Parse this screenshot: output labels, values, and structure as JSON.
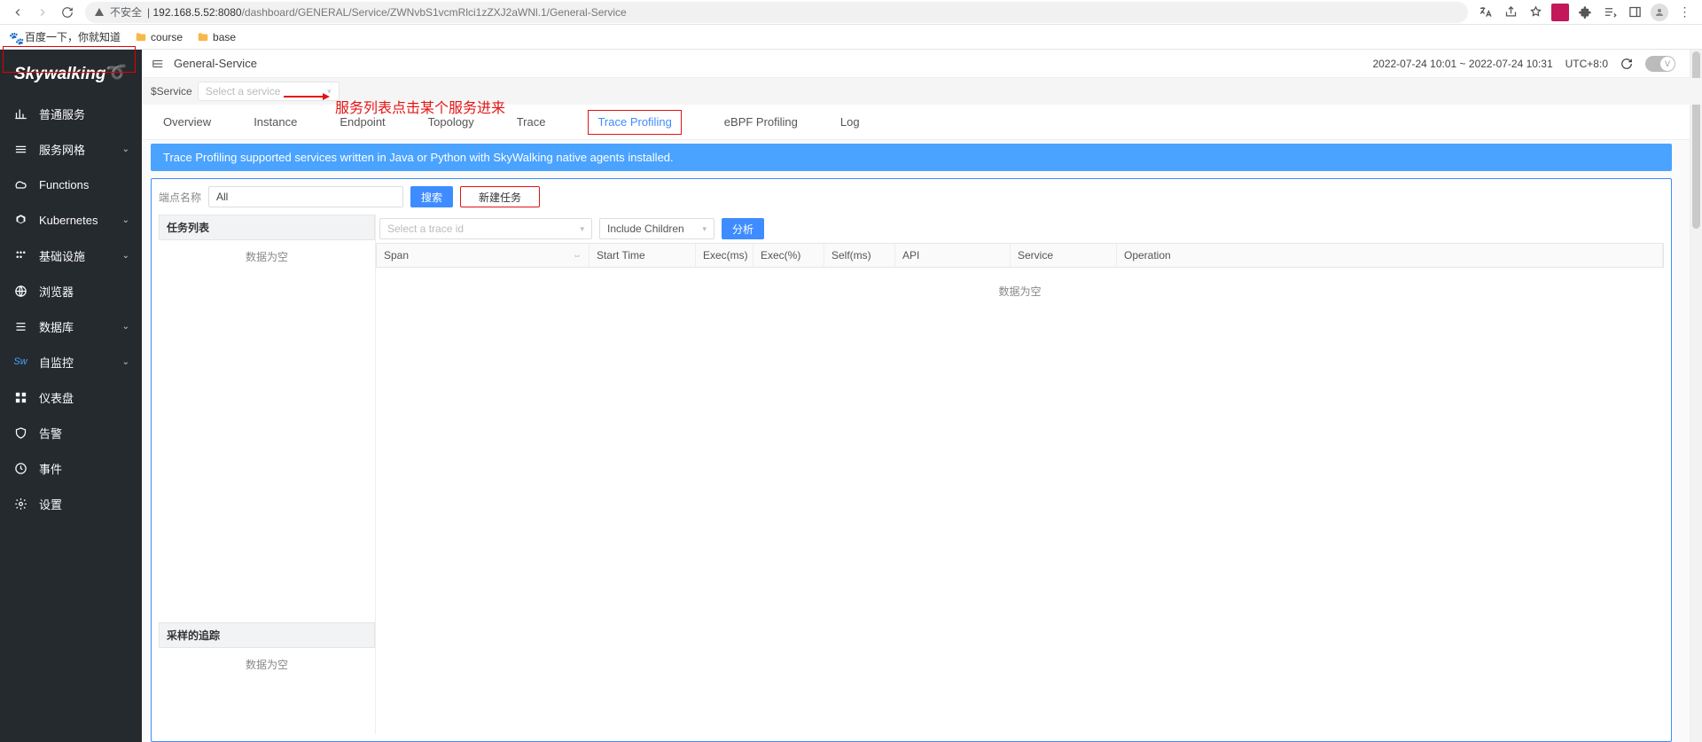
{
  "browser": {
    "insecure_label": "不安全",
    "url_host": "192.168.5.52:8080",
    "url_path": "/dashboard/GENERAL/Service/ZWNvbS1vcmRlci1zZXJ2aWNl.1/General-Service",
    "bookmarks": [
      {
        "label": "百度一下，你就知道"
      },
      {
        "label": "course"
      },
      {
        "label": "base"
      }
    ]
  },
  "logo": "Skywalking",
  "sidebar": [
    {
      "label": "普通服务",
      "icon": "chart",
      "expandable": false,
      "selected": true
    },
    {
      "label": "服务网格",
      "icon": "stack",
      "expandable": true
    },
    {
      "label": "Functions",
      "icon": "cloud",
      "expandable": false
    },
    {
      "label": "Kubernetes",
      "icon": "kube",
      "expandable": true
    },
    {
      "label": "基础设施",
      "icon": "dots",
      "expandable": true
    },
    {
      "label": "浏览器",
      "icon": "globe",
      "expandable": false
    },
    {
      "label": "数据库",
      "icon": "list",
      "expandable": true
    },
    {
      "label": "自监控",
      "icon": "sw",
      "expandable": true
    },
    {
      "label": "仪表盘",
      "icon": "grid",
      "expandable": false
    },
    {
      "label": "告警",
      "icon": "shield",
      "expandable": false
    },
    {
      "label": "事件",
      "icon": "clock",
      "expandable": false
    },
    {
      "label": "设置",
      "icon": "gear",
      "expandable": false
    }
  ],
  "header": {
    "breadcrumb": "General-Service",
    "time_range": "2022-07-24 10:01 ~ 2022-07-24 10:31",
    "timezone": "UTC+8:0",
    "toggle_label": "V"
  },
  "service_selector": {
    "label": "$Service",
    "placeholder": "Select a service"
  },
  "annotation": "服务列表点击某个服务进来",
  "tabs": [
    "Overview",
    "Instance",
    "Endpoint",
    "Topology",
    "Trace",
    "Trace Profiling",
    "eBPF Profiling",
    "Log"
  ],
  "active_tab": "Trace Profiling",
  "info_banner": "Trace Profiling supported services written in Java or Python with SkyWalking native agents installed.",
  "profiling": {
    "endpoint_label": "端点名称",
    "endpoint_value": "All",
    "search_btn": "搜索",
    "new_task_btn": "新建任务",
    "task_list_header": "任务列表",
    "task_list_empty": "数据为空",
    "sampled_header": "采样的追踪",
    "sampled_empty": "数据为空",
    "trace_select_placeholder": "Select a trace id",
    "include_children_value": "Include Children",
    "analyze_btn": "分析",
    "table_headers": [
      "Span",
      "Start Time",
      "Exec(ms)",
      "Exec(%)",
      "Self(ms)",
      "API",
      "Service",
      "Operation"
    ],
    "table_empty": "数据为空"
  }
}
